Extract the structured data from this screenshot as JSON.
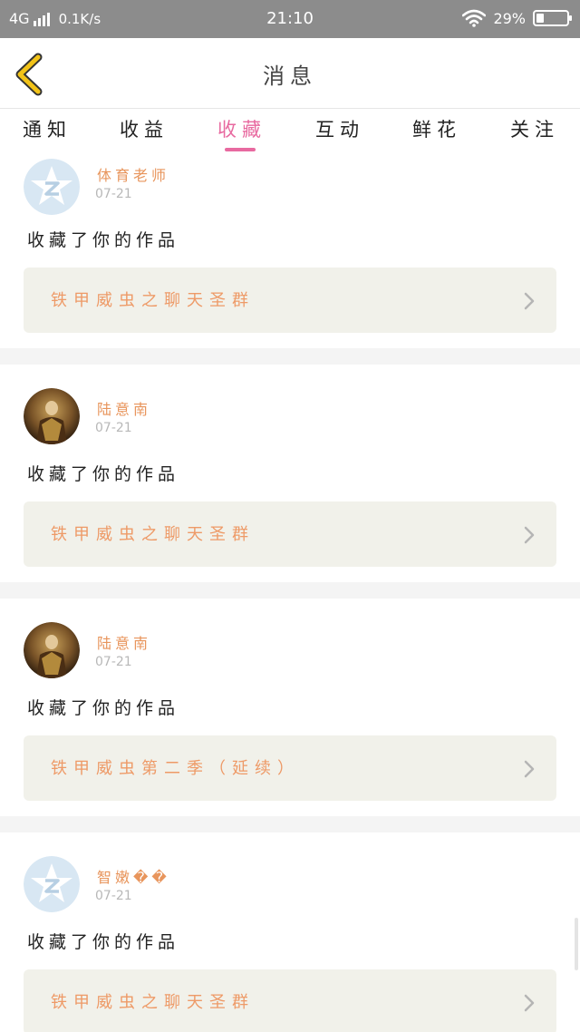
{
  "status_bar": {
    "network": "4G",
    "speed": "0.1K/s",
    "time": "21:10",
    "battery": "29%",
    "battery_level": 0.29,
    "wifi_icon": "wifi-icon"
  },
  "header": {
    "title": "消息",
    "back_icon": "chevron-left-icon",
    "back_color": "#f2c318"
  },
  "tabs": [
    {
      "label": "通知",
      "active": false
    },
    {
      "label": "收益",
      "active": false
    },
    {
      "label": "收藏",
      "active": true
    },
    {
      "label": "互动",
      "active": false
    },
    {
      "label": "鲜花",
      "active": false
    },
    {
      "label": "关注",
      "active": false
    }
  ],
  "colors": {
    "accent": "#e86aa0",
    "username": "#e8955c",
    "work_title": "#ee9a67",
    "work_box_bg": "#f1f1ea"
  },
  "notifications": [
    {
      "username": "体育老师",
      "date": "07-21",
      "action": "收藏了你的作品",
      "work_title": "铁甲威虫之聊天圣群",
      "avatar": "default-avatar-icon"
    },
    {
      "username": "陆意南",
      "date": "07-21",
      "action": "收藏了你的作品",
      "work_title": "铁甲威虫之聊天圣群",
      "avatar": "user-photo-avatar"
    },
    {
      "username": "陆意南",
      "date": "07-21",
      "action": "收藏了你的作品",
      "work_title": "铁甲威虫第二季（延续）",
      "avatar": "user-photo-avatar"
    },
    {
      "username": "智嫩��",
      "date": "07-21",
      "action": "收藏了你的作品",
      "work_title": "铁甲威虫之聊天圣群",
      "avatar": "default-avatar-icon"
    }
  ]
}
